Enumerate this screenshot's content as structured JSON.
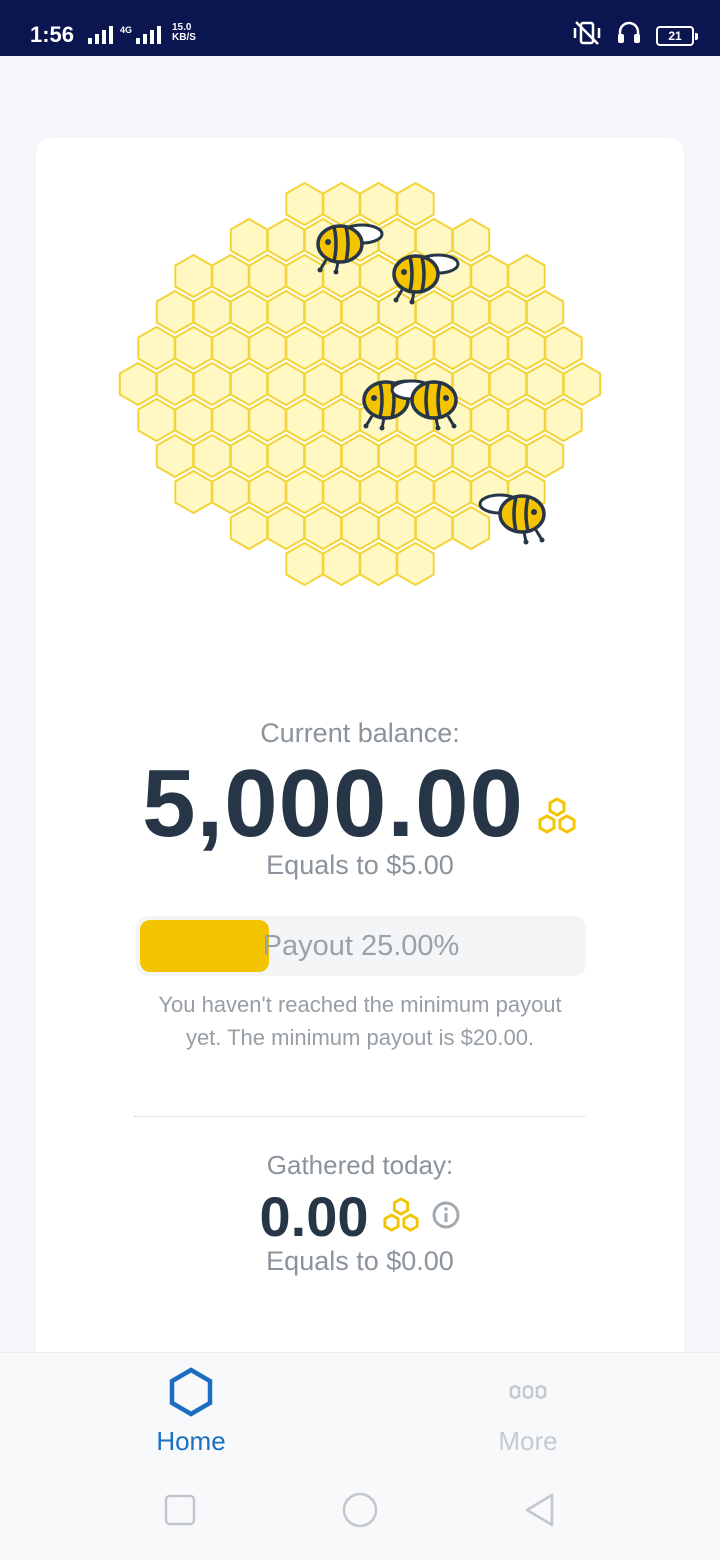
{
  "status": {
    "time": "1:56",
    "network": "4G",
    "speed_value": "15.0",
    "speed_unit": "KB/S",
    "battery": "21"
  },
  "balance": {
    "label": "Current balance:",
    "value": "5,000.00",
    "equals": "Equals to $5.00"
  },
  "payout": {
    "label": "Payout 25.00%",
    "progress_fraction": 0.25,
    "note": "You haven't reached the minimum payout yet. The minimum payout is $20.00."
  },
  "gathered": {
    "label": "Gathered today:",
    "value": "0.00",
    "equals": "Equals to $0.00"
  },
  "nav": {
    "home": "Home",
    "more": "More"
  },
  "colors": {
    "accent": "#f5c400",
    "hex_fill": "#fff8c2",
    "hex_stroke": "#f2d43a",
    "text_dark": "#263646",
    "text_muted": "#8b949c",
    "primary_blue": "#1b6ec2",
    "status_bar": "#0b1550"
  },
  "icons": {
    "home": "hexagon-icon",
    "more": "three-dots-icon",
    "currency": "honeycomb-icon",
    "info": "info-icon"
  }
}
